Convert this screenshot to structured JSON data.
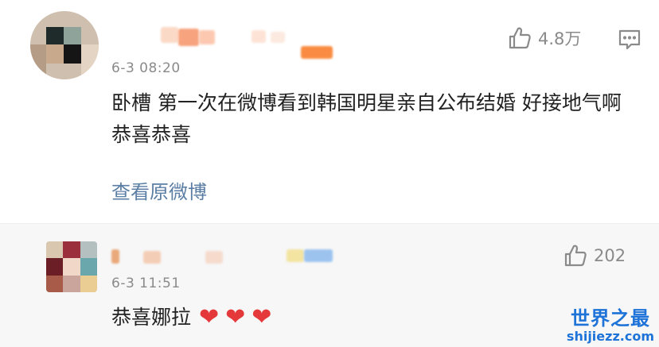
{
  "comments": [
    {
      "time": "6-3 08:20",
      "text": "卧槽 第一次在微博看到韩国明星亲自公布结婚 好接地气啊 恭喜恭喜",
      "likes": "4.8万",
      "link": "查看原微博"
    },
    {
      "time": "6-3 11:51",
      "text": "恭喜娜拉",
      "likes": "202",
      "emoji": "❤"
    }
  ],
  "watermark": {
    "title": "世界之最",
    "domain": "shijiezz.com"
  },
  "colors": {
    "link": "#5b7ea4",
    "meta": "#8a8a8a",
    "heart": "#e5383b",
    "watermark": "#1e73d8"
  }
}
